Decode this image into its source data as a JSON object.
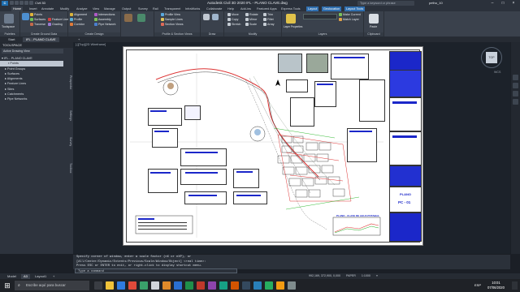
{
  "titlebar": {
    "app_title": "Autodesk Civil 3D 2020   IFL - PLANO CLAVE.dwg",
    "logo": "C",
    "workspace": "Civil 3D",
    "search_placeholder": "Type a keyword or phrase",
    "user": "petho_10"
  },
  "ribbon_tabs": [
    "Home",
    "Insert",
    "Annotate",
    "Modify",
    "Analyze",
    "View",
    "Manage",
    "Output",
    "Survey",
    "Rail",
    "Transparent",
    "InfraWorks",
    "Collaborate",
    "Help",
    "Add-ins",
    "Featured Apps",
    "Express Tools",
    "Layout",
    "Geolocation",
    "Layout Tools"
  ],
  "ribbon": {
    "palettes": {
      "title": "Palettes",
      "toolspace": "Toolspace"
    },
    "create_ground": {
      "title": "Create Ground Data",
      "items": [
        "Points",
        "Surfaces",
        "Traverse",
        "Feature Line",
        "Grading"
      ]
    },
    "create_design": {
      "title": "Create Design",
      "items": [
        "Alignment",
        "Profile",
        "Corridor",
        "Intersections",
        "Assembly",
        "Pipe Network"
      ]
    },
    "profile_views": {
      "title": "Profile & Section Views",
      "items": [
        "Profile View",
        "Sample Lines",
        "Section Views"
      ]
    },
    "draw": {
      "title": "Draw"
    },
    "modify": {
      "title": "Modify",
      "items": [
        "Move",
        "Rotate",
        "Trim",
        "Copy",
        "Mirror",
        "Fillet",
        "Stretch",
        "Scale",
        "Array"
      ]
    },
    "layers": {
      "title": "Layers",
      "items": [
        "Layer Properties",
        "Make Current",
        "Match Layer"
      ]
    },
    "clipboard": {
      "title": "Clipboard",
      "paste": "Paste"
    }
  },
  "file_tabs": [
    "Start",
    "IFL - PLANO CLAVE"
  ],
  "toolspace": {
    "header": "TOOLSPACE",
    "dropdown": "Active Drawing View",
    "tree": [
      "IFL - PLANO CLAVE",
      "Points",
      "Point Groups",
      "Surfaces",
      "Alignments",
      "Feature Lines",
      "Sites",
      "Catchments",
      "Pipe Networks"
    ],
    "side_tabs": [
      "Prospector",
      "Settings",
      "Survey",
      "Toolbox"
    ]
  },
  "viewport": {
    "controls": "[-][Top][2D Wireframe]",
    "viewcube_face": "TOP",
    "wcs": "WCS"
  },
  "sheet": {
    "profile_title": "PLANO - CLAVE DE AGUA POTABLE",
    "title_block": [
      "PLANO",
      "PC - 01"
    ]
  },
  "command": {
    "lines": [
      "Specify corner of window, enter a scale factor (nX or nXP), or",
      "[All/Center/Dynamic/Extents/Previous/Scale/Window/Object] <real time>:",
      "Press ESC or ENTER to exit, or right-click to display shortcut menu."
    ],
    "input_placeholder": "Type a command"
  },
  "layout_tabs": [
    "Model",
    "A3",
    "Layout1",
    "+"
  ],
  "status": {
    "coords": "992,169, 372,900, 0,000",
    "mode": "PAPER",
    "scale": "1:1000"
  },
  "taskbar": {
    "search": "Escribe aquí para buscar",
    "lang": "ESP",
    "time": "10:01",
    "date": "07/06/2020"
  },
  "colors": {
    "accent": "#1f6fb2",
    "sheet_blue": "#1b27c9",
    "ribbon_bg": "#3a414c"
  }
}
